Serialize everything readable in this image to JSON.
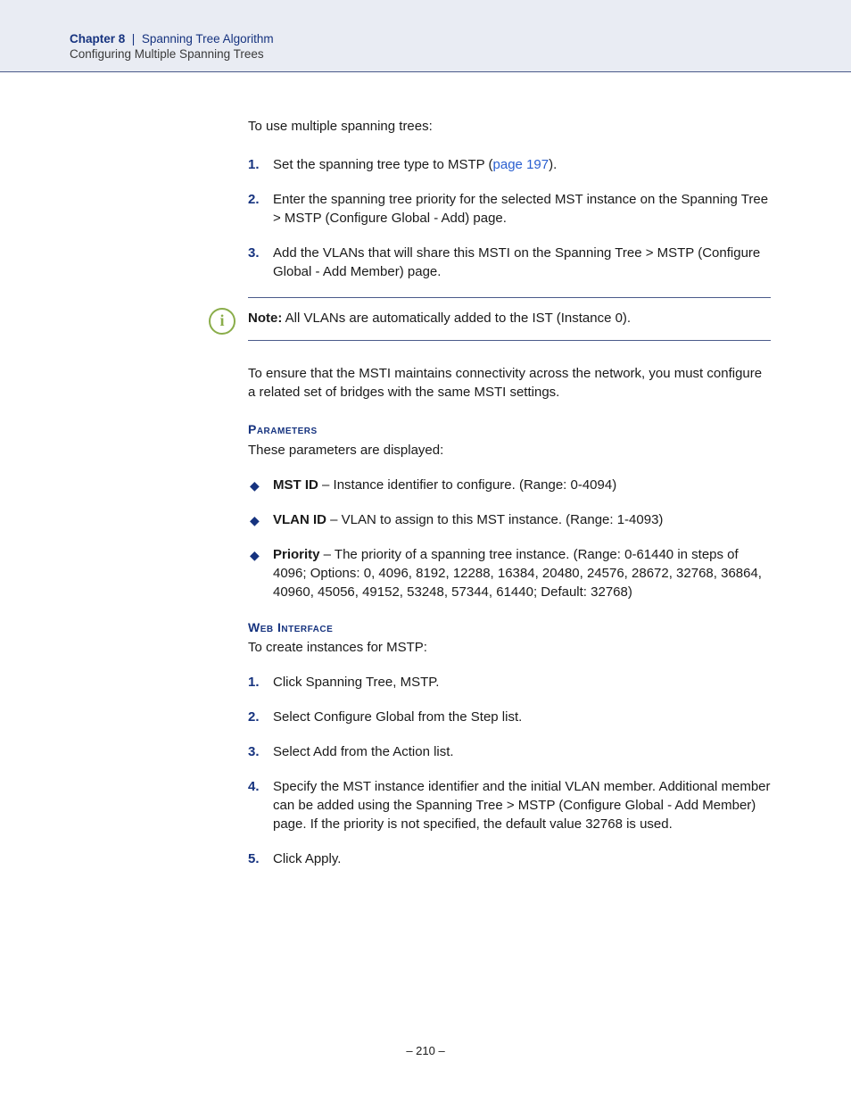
{
  "header": {
    "chapter_label": "Chapter 8",
    "separator": "|",
    "chapter_title": "Spanning Tree Algorithm",
    "subsection": "Configuring Multiple Spanning Trees"
  },
  "intro": "To use multiple spanning trees:",
  "steps": [
    {
      "num": "1.",
      "text_before": "Set the spanning tree type to MSTP (",
      "link": "page 197",
      "text_after": ")."
    },
    {
      "num": "2.",
      "text": "Enter the spanning tree priority for the selected MST instance on the Spanning Tree > MSTP (Configure Global - Add) page."
    },
    {
      "num": "3.",
      "text": "Add the VLANs that will share this MSTI on the Spanning Tree > MSTP (Configure Global - Add Member) page."
    }
  ],
  "note": {
    "label": "Note:",
    "text": " All VLANs are automatically added to the IST (Instance 0)."
  },
  "ensure": "To ensure that the MSTI maintains connectivity across the network, you must configure a related set of bridges with the same MSTI settings.",
  "params": {
    "heading": "Parameters",
    "intro": "These parameters are displayed:",
    "items": [
      {
        "label": "MST ID",
        "desc": " – Instance identifier to configure. (Range: 0-4094)"
      },
      {
        "label": "VLAN ID",
        "desc": " – VLAN to assign to this MST instance. (Range: 1-4093)"
      },
      {
        "label": "Priority",
        "desc": " – The priority of a spanning tree instance. (Range: 0-61440 in steps of 4096; Options: 0, 4096, 8192, 12288, 16384, 20480, 24576, 28672, 32768, 36864, 40960, 45056, 49152, 53248, 57344, 61440; Default: 32768)"
      }
    ]
  },
  "web": {
    "heading": "Web Interface",
    "intro": "To create instances for MSTP:",
    "steps": [
      {
        "num": "1.",
        "text": "Click Spanning Tree, MSTP."
      },
      {
        "num": "2.",
        "text": "Select Configure Global from the Step list."
      },
      {
        "num": "3.",
        "text": "Select Add from the Action list."
      },
      {
        "num": "4.",
        "text": "Specify the MST instance identifier and the initial VLAN member. Additional member can be added using the Spanning Tree > MSTP (Configure Global - Add Member) page. If the priority is not specified, the default value 32768 is used."
      },
      {
        "num": "5.",
        "text": "Click Apply."
      }
    ]
  },
  "page_number": "– 210 –"
}
